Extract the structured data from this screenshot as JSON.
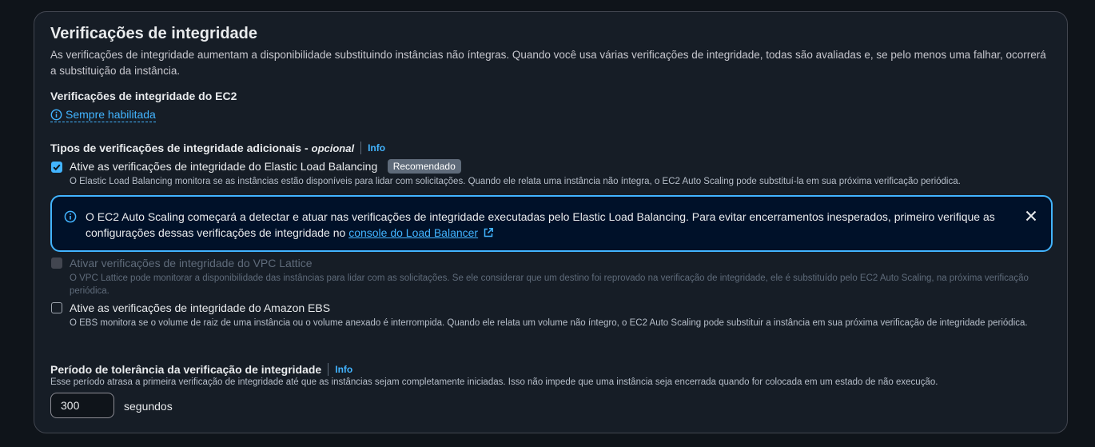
{
  "section": {
    "title": "Verificações de integridade",
    "description": "As verificações de integridade aumentam a disponibilidade substituindo instâncias não íntegras. Quando você usa várias verificações de integridade, todas são avaliadas e, se pelo menos uma falhar, ocorrerá a substituição da instância."
  },
  "ec2": {
    "label": "Verificações de integridade do EC2",
    "status": "Sempre habilitada"
  },
  "additional": {
    "label": "Tipos de verificações de integridade adicionais -",
    "optional": "opcional",
    "info": "Info",
    "elb": {
      "checked": true,
      "label": "Ative as verificações de integridade do Elastic Load Balancing",
      "badge": "Recomendado",
      "description": "O Elastic Load Balancing monitora se as instâncias estão disponíveis para lidar com solicitações. Quando ele relata uma instância não íntegra, o EC2 Auto Scaling pode substituí-la em sua próxima verificação periódica."
    },
    "alert": {
      "text": "O EC2 Auto Scaling começará a detectar e atuar nas verificações de integridade executadas pelo Elastic Load Balancing. Para evitar encerramentos inesperados, primeiro verifique as configurações dessas verificações de integridade no",
      "link": "console do Load Balancer"
    },
    "vpc": {
      "checked": false,
      "disabled": true,
      "label": "Ativar verificações de integridade do VPC Lattice",
      "description": "O VPC Lattice pode monitorar a disponibilidade das instâncias para lidar com as solicitações. Se ele considerar que um destino foi reprovado na verificação de integridade, ele é substituído pelo EC2 Auto Scaling, na próxima verificação periódica."
    },
    "ebs": {
      "checked": false,
      "label": "Ative as verificações de integridade do Amazon EBS",
      "description": "O EBS monitora se o volume de raiz de uma instância ou o volume anexado é interrompida. Quando ele relata um volume não íntegro, o EC2 Auto Scaling pode substituir a instância em sua próxima verificação de integridade periódica."
    }
  },
  "grace": {
    "label": "Período de tolerância da verificação de integridade",
    "info": "Info",
    "description": "Esse período atrasa a primeira verificação de integridade até que as instâncias sejam completamente iniciadas. Isso não impede que uma instância seja encerrada quando for colocada em um estado de não execução.",
    "value": "300",
    "unit": "segundos"
  },
  "colors": {
    "accent": "#42b4ff",
    "panel": "#161d26",
    "alert_bg": "#001129"
  },
  "icons": [
    "info-circle-icon",
    "check-icon",
    "close-icon",
    "external-link-icon"
  ]
}
